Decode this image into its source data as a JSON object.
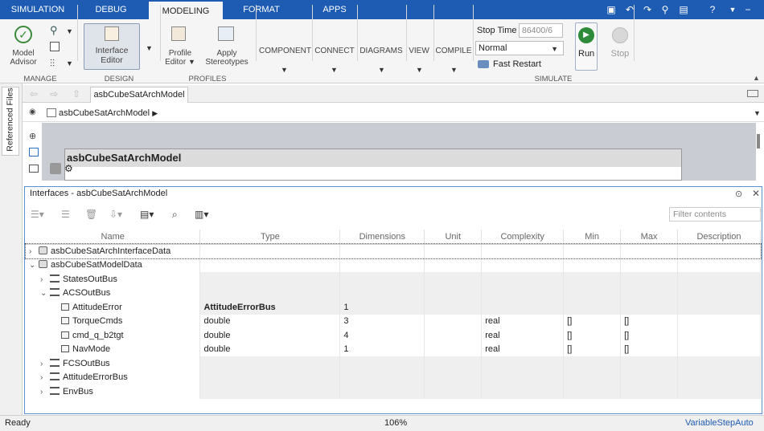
{
  "tabs": [
    "SIMULATION",
    "DEBUG",
    "MODELING",
    "FORMAT",
    "APPS"
  ],
  "quick_access": [
    "save-icon",
    "undo-icon",
    "redo-icon",
    "search-icon",
    "window-icon",
    "help-icon"
  ],
  "ribbon": {
    "model_advisor": [
      "Model",
      "Advisor"
    ],
    "interface_editor": [
      "Interface",
      "Editor"
    ],
    "profile_editor": [
      "Profile",
      "Editor"
    ],
    "apply_stereotypes": [
      "Apply",
      "Stereotypes"
    ],
    "component": "COMPONENT",
    "connect": "CONNECT",
    "diagrams": "DIAGRAMS",
    "view": "VIEW",
    "compile": "COMPILE",
    "stop_time_label": "Stop Time",
    "stop_time_value": "86400/6",
    "sim_mode": "Normal",
    "fast_restart": "Fast Restart",
    "run": "Run",
    "stop": "Stop",
    "groups": {
      "manage": "MANAGE",
      "design": "DESIGN",
      "profiles": "PROFILES",
      "simulate": "SIMULATE"
    }
  },
  "side_tab": "Referenced Files",
  "doc_tab": "asbCubeSatArchModel",
  "breadcrumb": "asbCubeSatArchModel",
  "canvas_title": "asbCubeSatArchModel",
  "panel": {
    "title": "Interfaces - asbCubeSatArchModel",
    "filter_placeholder": "Filter contents",
    "columns": [
      "Name",
      "Type",
      "Dimensions",
      "Unit",
      "Complexity",
      "Min",
      "Max",
      "Description"
    ],
    "rows": [
      {
        "level": 0,
        "expander": ">",
        "icon": "dictionary",
        "name": "asbCubeSatArchInterfaceData",
        "type": "",
        "dims": "",
        "unit": "",
        "complexity": "",
        "min": "",
        "max": "",
        "grey": false
      },
      {
        "level": 0,
        "expander": "v",
        "icon": "dictionary",
        "name": "asbCubeSatModelData",
        "type": "",
        "dims": "",
        "unit": "",
        "complexity": "",
        "min": "",
        "max": "",
        "grey": false
      },
      {
        "level": 1,
        "expander": ">",
        "icon": "bus",
        "name": "StatesOutBus",
        "type": "",
        "dims": "",
        "unit": "",
        "complexity": "",
        "min": "",
        "max": "",
        "grey": true
      },
      {
        "level": 1,
        "expander": "v",
        "icon": "bus",
        "name": "ACSOutBus",
        "type": "",
        "dims": "",
        "unit": "",
        "complexity": "",
        "min": "",
        "max": "",
        "grey": true
      },
      {
        "level": 2,
        "expander": "",
        "icon": "element",
        "name": "AttitudeError",
        "type": "AttitudeErrorBus",
        "dims": "1",
        "unit": "",
        "complexity": "",
        "min": "",
        "max": "",
        "grey": true,
        "bold": true
      },
      {
        "level": 2,
        "expander": "",
        "icon": "element",
        "name": "TorqueCmds",
        "type": "double",
        "dims": "3",
        "unit": "",
        "complexity": "real",
        "min": "[]",
        "max": "[]",
        "grey": false
      },
      {
        "level": 2,
        "expander": "",
        "icon": "element",
        "name": "cmd_q_b2tgt",
        "type": "double",
        "dims": "4",
        "unit": "",
        "complexity": "real",
        "min": "[]",
        "max": "[]",
        "grey": false
      },
      {
        "level": 2,
        "expander": "",
        "icon": "element",
        "name": "NavMode",
        "type": "double",
        "dims": "1",
        "unit": "",
        "complexity": "real",
        "min": "[]",
        "max": "[]",
        "grey": false
      },
      {
        "level": 1,
        "expander": ">",
        "icon": "bus",
        "name": "FCSOutBus",
        "type": "",
        "dims": "",
        "unit": "",
        "complexity": "",
        "min": "",
        "max": "",
        "grey": true
      },
      {
        "level": 1,
        "expander": ">",
        "icon": "bus",
        "name": "AttitudeErrorBus",
        "type": "",
        "dims": "",
        "unit": "",
        "complexity": "",
        "min": "",
        "max": "",
        "grey": true
      },
      {
        "level": 1,
        "expander": ">",
        "icon": "bus",
        "name": "EnvBus",
        "type": "",
        "dims": "",
        "unit": "",
        "complexity": "",
        "min": "",
        "max": "",
        "grey": true
      }
    ]
  },
  "status": {
    "left": "Ready",
    "zoom": "106%",
    "solver": "VariableStepAuto"
  }
}
